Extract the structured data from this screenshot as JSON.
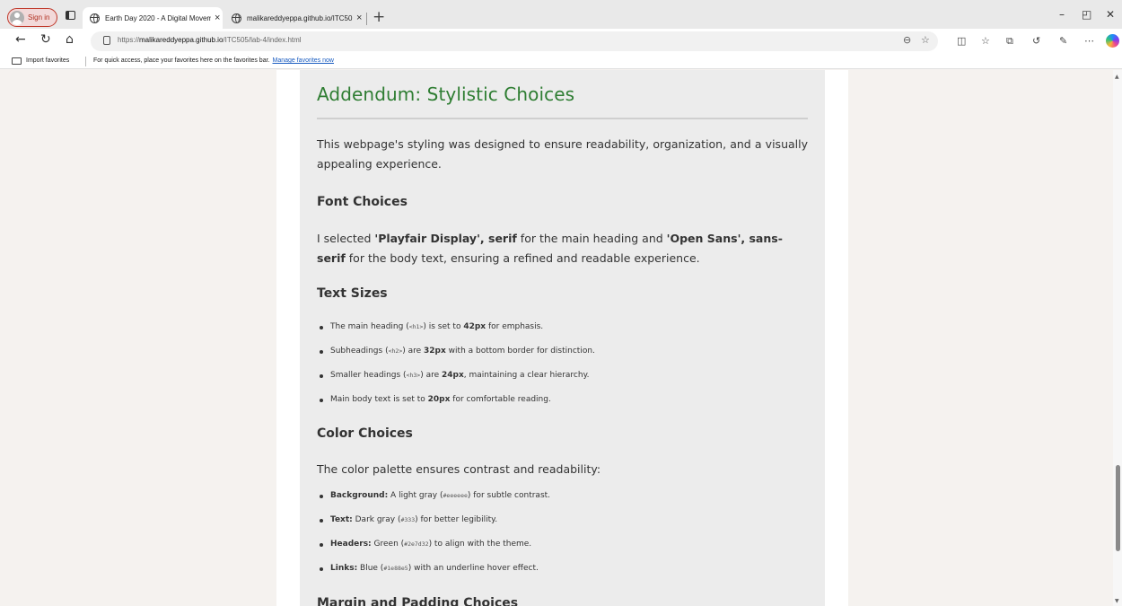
{
  "browser": {
    "signin_label": "Sign in",
    "tabs": [
      {
        "title": "Earth Day 2020 - A Digital Movem",
        "active": true
      },
      {
        "title": "malikareddyeppa.github.io/ITC50",
        "active": false
      }
    ],
    "tab_close": "×",
    "new_tab": "+",
    "window_controls": {
      "minimize": "–",
      "restore": "◰",
      "close": "✕"
    },
    "nav": {
      "back": "←",
      "refresh": "↻",
      "home": "⌂"
    },
    "url_prefix": "https://",
    "url_host": "malikareddyeppa.github.io",
    "url_path": "/ITC505/lab-4/index.html",
    "favorites_bar": {
      "import_label": "Import favorites",
      "hint": "For quick access, place your favorites here on the favorites bar.",
      "manage_link": "Manage favorites now"
    },
    "accent_color": "#c0392b"
  },
  "page": {
    "addendum_heading": "Addendum: Stylistic Choices",
    "intro": "This webpage's styling was designed to ensure readability, organization, and a visually appealing experience.",
    "font_choices": {
      "heading": "Font Choices",
      "text_before": "I selected ",
      "heading_font": "'Playfair Display', serif",
      "text_middle": " for the main heading and ",
      "body_font": "'Open Sans', sans-serif",
      "text_after": " for the body text, ensuring a refined and readable experience."
    },
    "text_sizes": {
      "heading": "Text Sizes",
      "items": [
        {
          "pre": "The main heading (",
          "code": "<h1>",
          "mid": ") is set to ",
          "bold": "42px",
          "post": " for emphasis."
        },
        {
          "pre": "Subheadings (",
          "code": "<h2>",
          "mid": ") are ",
          "bold": "32px",
          "post": " with a bottom border for distinction."
        },
        {
          "pre": "Smaller headings (",
          "code": "<h3>",
          "mid": ") are ",
          "bold": "24px",
          "post": ", maintaining a clear hierarchy."
        },
        {
          "pre": "Main body text is set to ",
          "code": "",
          "mid": "",
          "bold": "20px",
          "post": " for comfortable reading."
        }
      ]
    },
    "color_choices": {
      "heading": "Color Choices",
      "intro": "The color palette ensures contrast and readability:",
      "items": [
        {
          "label": "Background:",
          "pre": " A light gray (",
          "code": "#eeeeee",
          "post": ") for subtle contrast."
        },
        {
          "label": "Text:",
          "pre": " Dark gray (",
          "code": "#333",
          "post": ") for better legibility."
        },
        {
          "label": "Headers:",
          "pre": " Green (",
          "code": "#2e7d32",
          "post": ") to align with the theme."
        },
        {
          "label": "Links:",
          "pre": " Blue (",
          "code": "#1e88e5",
          "post": ") with an underline hover effect."
        }
      ]
    },
    "margin_heading": "Margin and Padding Choices",
    "colors": {
      "header_green": "#2e7d32",
      "section_bg": "#eeeeee",
      "text": "#333333"
    }
  }
}
